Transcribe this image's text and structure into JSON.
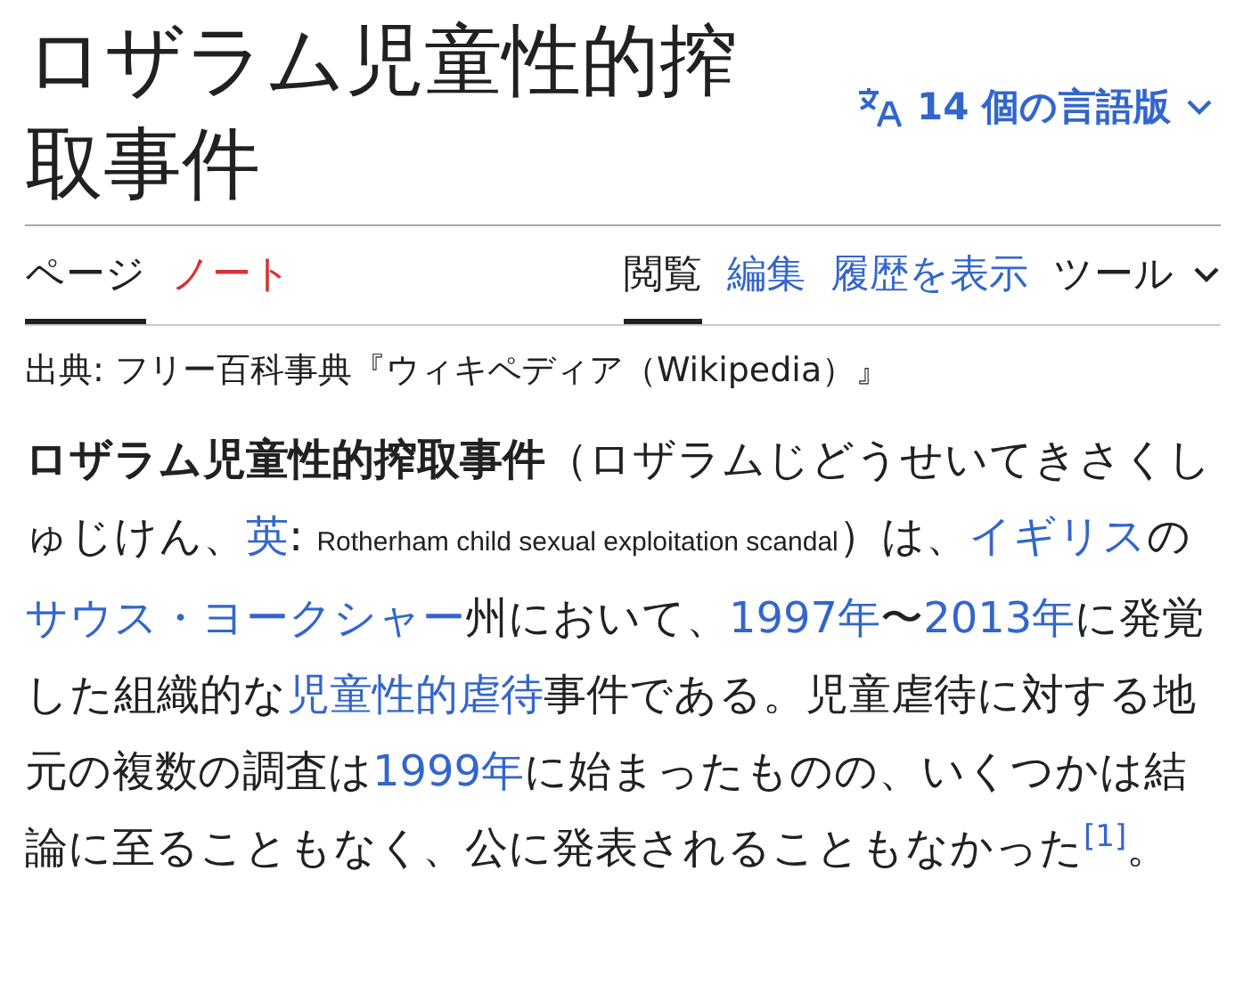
{
  "title": "ロザラム児童性的搾取事件",
  "languages": {
    "label": "14 個の言語版"
  },
  "tabs_left": [
    {
      "label": "ページ",
      "selected": true,
      "kind": "tab"
    },
    {
      "label": "ノート",
      "selected": false,
      "kind": "redlink"
    }
  ],
  "tabs_right": [
    {
      "label": "閲覧",
      "selected": true,
      "kind": "tab"
    },
    {
      "label": "編集",
      "selected": false,
      "kind": "tab"
    },
    {
      "label": "履歴を表示",
      "selected": false,
      "kind": "tab"
    },
    {
      "label": "ツール",
      "selected": false,
      "kind": "menu"
    }
  ],
  "source": "出典: フリー百科事典『ウィキペディア（Wikipedia）』",
  "paragraph": [
    {
      "text": "ロザラム児童性的搾取事件",
      "kind": "bold"
    },
    {
      "text": "（ロザラムじどうせいてきさくしゅじけん、",
      "kind": "plain"
    },
    {
      "text": "英",
      "kind": "link"
    },
    {
      "text": ": ",
      "kind": "plain"
    },
    {
      "text": "Rotherham child sexual exploitation scandal",
      "kind": "small"
    },
    {
      "text": "）は、",
      "kind": "plain"
    },
    {
      "text": "イギリス",
      "kind": "link"
    },
    {
      "text": "の",
      "kind": "plain"
    },
    {
      "text": "サウス・ヨークシャー",
      "kind": "link"
    },
    {
      "text": "州において、",
      "kind": "plain"
    },
    {
      "text": "1997年",
      "kind": "link"
    },
    {
      "text": "〜",
      "kind": "plain"
    },
    {
      "text": "2013年",
      "kind": "link"
    },
    {
      "text": "に発覚した組織的な",
      "kind": "plain"
    },
    {
      "text": "児童性的虐待",
      "kind": "link"
    },
    {
      "text": "事件である。児童虐待に対する地元の複数の調査は",
      "kind": "plain"
    },
    {
      "text": "1999年",
      "kind": "link"
    },
    {
      "text": "に始まったものの、いくつかは結論に至ることもなく、公に発表されることもなかった",
      "kind": "plain"
    },
    {
      "text": "[1]",
      "kind": "ref"
    },
    {
      "text": "。",
      "kind": "plain"
    }
  ]
}
